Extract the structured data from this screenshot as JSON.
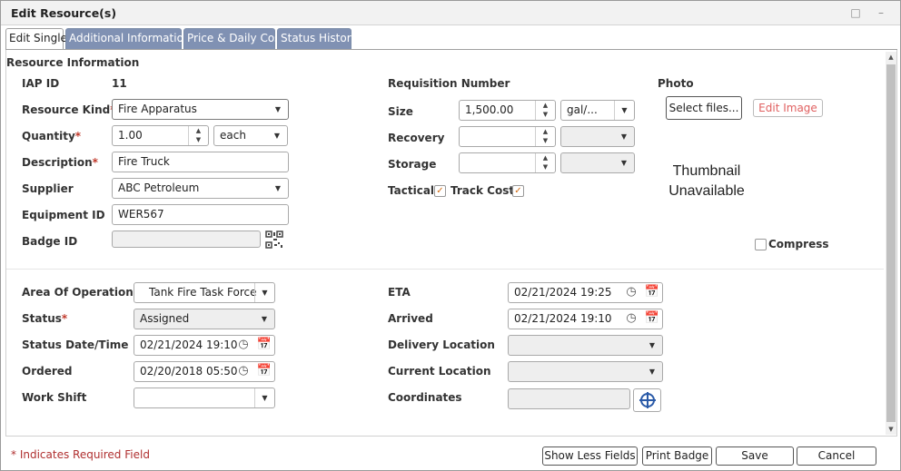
{
  "window": {
    "title": "Edit Resource(s)",
    "minimize_icon": "minimize-icon",
    "restore_icon": "restore-icon"
  },
  "tabs": [
    {
      "label": "Edit Single",
      "active": true
    },
    {
      "label": "Additional Information",
      "active": false
    },
    {
      "label": "Price & Daily Cost",
      "active": false
    },
    {
      "label": "Status History",
      "active": false
    }
  ],
  "section_title": "Resource Information",
  "left": {
    "iap_id": {
      "label": "IAP ID",
      "value": "11"
    },
    "resource_kind": {
      "label": "Resource Kind",
      "value": "Fire Apparatus",
      "required": "*"
    },
    "quantity": {
      "label": "Quantity",
      "value": "1.00",
      "unit": "each",
      "required": "*"
    },
    "description": {
      "label": "Description",
      "value": "Fire Truck",
      "required": "*"
    },
    "supplier": {
      "label": "Supplier",
      "value": "ABC Petroleum"
    },
    "equipment_id": {
      "label": "Equipment ID",
      "value": "WER567"
    },
    "badge_id": {
      "label": "Badge ID",
      "value": "",
      "icon": "qr-code-icon"
    }
  },
  "middle": {
    "requisition_number": {
      "label": "Requisition Number"
    },
    "size": {
      "label": "Size",
      "value": "1,500.00",
      "unit": "gal/..."
    },
    "recovery": {
      "label": "Recovery",
      "value": "",
      "unit": ""
    },
    "storage": {
      "label": "Storage",
      "value": "",
      "unit": ""
    },
    "tactical": {
      "label": "Tactical",
      "checked": true
    },
    "track_cost": {
      "label": "Track Cost",
      "checked": true
    }
  },
  "photo": {
    "label": "Photo",
    "select_files": "Select files...",
    "edit_image": "Edit Image",
    "thumbnail_line1": "Thumbnail",
    "thumbnail_line2": "Unavailable",
    "compress_label": "Compress",
    "compress_checked": false
  },
  "lower_left": {
    "area_of_operation": {
      "label": "Area Of Operation",
      "value": "Tank Fire Task Force",
      "required": "*"
    },
    "status": {
      "label": "Status",
      "value": "Assigned",
      "required": "*"
    },
    "status_datetime": {
      "label": "Status Date/Time",
      "value": "02/21/2024 19:10"
    },
    "ordered": {
      "label": "Ordered",
      "value": "02/20/2018 05:50"
    },
    "work_shift": {
      "label": "Work Shift",
      "value": ""
    }
  },
  "lower_right": {
    "eta": {
      "label": "ETA",
      "value": "02/21/2024 19:25"
    },
    "arrived": {
      "label": "Arrived",
      "value": "02/21/2024 19:10"
    },
    "delivery_location": {
      "label": "Delivery Location",
      "value": ""
    },
    "current_location": {
      "label": "Current Location",
      "value": ""
    },
    "coordinates": {
      "label": "Coordinates",
      "value": "",
      "icon": "crosshair-icon"
    }
  },
  "footer": {
    "required_note": "* Indicates Required Field",
    "show_less": "Show Less Fields",
    "print_badge": "Print Badge",
    "save": "Save",
    "cancel": "Cancel"
  },
  "colors": {
    "tab_inactive": "#8091b3",
    "required": "#c0392b",
    "checkbox_check": "#d06a10",
    "edit_image": "#e06060",
    "crosshair": "#2a5aa8"
  }
}
